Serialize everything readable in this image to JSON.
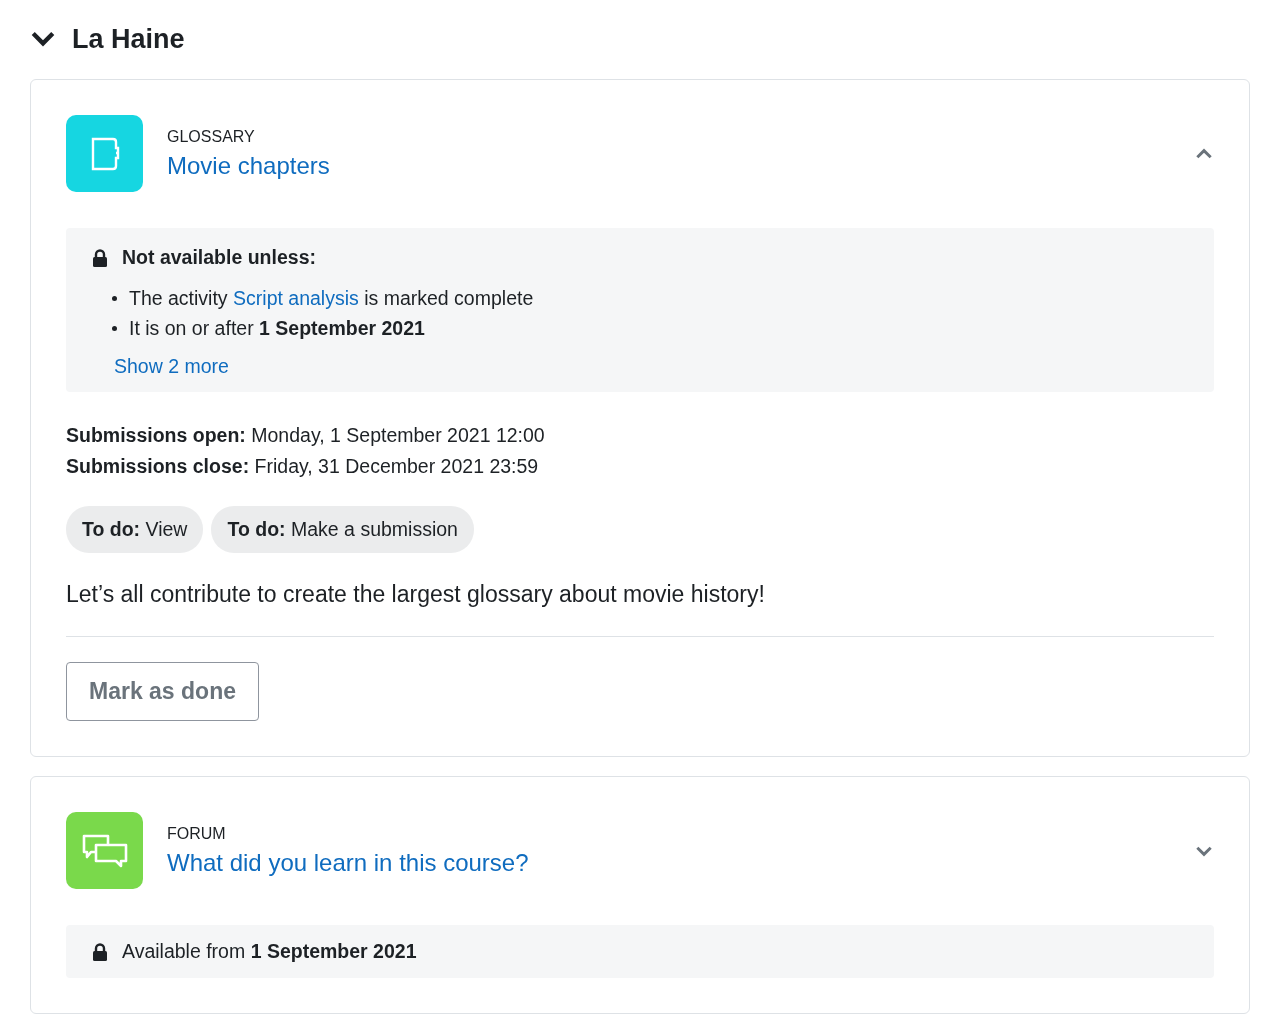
{
  "section": {
    "title": "La Haine",
    "expanded": true
  },
  "activities": [
    {
      "kind": "glossary",
      "type_label": "GLOSSARY",
      "name": "Movie chapters",
      "expanded": true,
      "restriction": {
        "kind": "list",
        "heading": "Not available unless:",
        "conditions": [
          {
            "kind": "link",
            "before": "The activity ",
            "link": "Script analysis",
            "after": " is marked complete"
          },
          {
            "kind": "text",
            "text": "It is on or after **1 September 2021**"
          }
        ],
        "more": "Show 2 more"
      },
      "dates": [
        {
          "label": "Submissions open:",
          "value": "Monday, 1 September 2021 12:00"
        },
        {
          "label": "Submissions close:",
          "value": "Friday, 31 December 2021 23:59"
        }
      ],
      "todos": [
        {
          "label": "To do:",
          "value": "View"
        },
        {
          "label": "To do:",
          "value": "Make a submission"
        }
      ],
      "description": "Let’s all contribute to create the largest glossary about movie history!",
      "button": "Mark as done"
    },
    {
      "kind": "forum",
      "type_label": "FORUM",
      "name": "What did you learn in this course?",
      "expanded": false,
      "restriction": {
        "kind": "line",
        "text": "Available from **1 September 2021**"
      }
    }
  ]
}
